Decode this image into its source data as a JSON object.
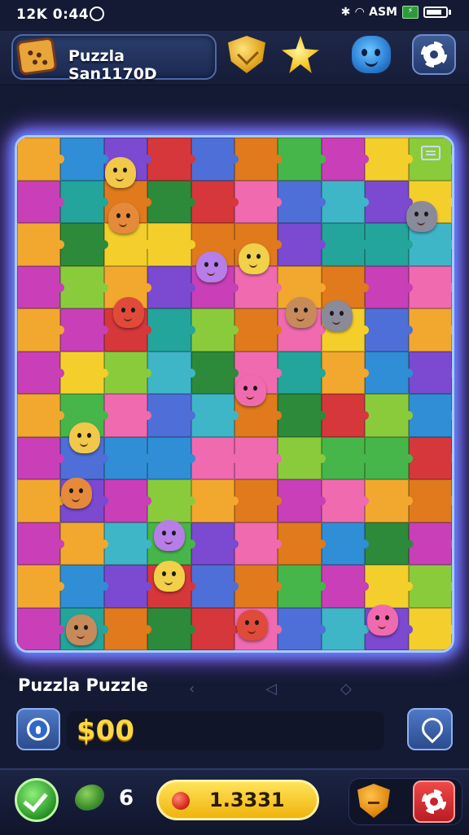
{
  "status_bar": {
    "time": "12K 0:44",
    "carrier": "ASM"
  },
  "header": {
    "title": "Puzzla San1170D"
  },
  "board": {
    "columns": 10,
    "rows": 12,
    "palette": [
      "#f2a82e",
      "#e07a1d",
      "#3fb6c8",
      "#2f8ed6",
      "#47b64a",
      "#2d8a3a",
      "#7b4ad0",
      "#c93fb8",
      "#f06ab0",
      "#d6373b",
      "#f4cf2b",
      "#23a59b",
      "#4f6fd8",
      "#8acb3c"
    ],
    "critter_colors": [
      "#f2c84a",
      "#e58a3a",
      "#b77de8",
      "#f1d04a",
      "#e04a3a",
      "#c78a5a",
      "#8a8a9a",
      "#f06ab0"
    ]
  },
  "footer": {
    "puzzle_label": "Puzzla Puzzle",
    "money": "$00"
  },
  "bottom_bar": {
    "leaf_count": "6",
    "score": "1.3331"
  }
}
